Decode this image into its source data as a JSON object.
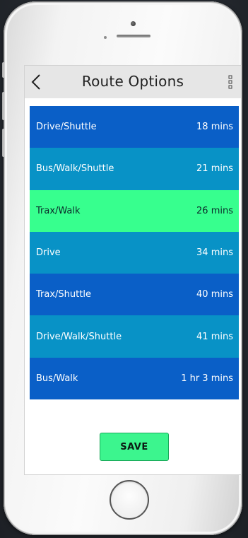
{
  "header": {
    "title": "Route Options"
  },
  "icons": {
    "back": "chevron-left-icon",
    "menu": "vertical-dots-icon",
    "home": "home-button-ring"
  },
  "routes": [
    {
      "mode": "Drive/Shuttle",
      "duration": "18 mins",
      "selected": false
    },
    {
      "mode": "Bus/Walk/Shuttle",
      "duration": "21 mins",
      "selected": false
    },
    {
      "mode": "Trax/Walk",
      "duration": "26 mins",
      "selected": true
    },
    {
      "mode": "Drive",
      "duration": "34 mins",
      "selected": false
    },
    {
      "mode": "Trax/Shuttle",
      "duration": "40 mins",
      "selected": false
    },
    {
      "mode": "Drive/Walk/Shuttle",
      "duration": "41 mins",
      "selected": false
    },
    {
      "mode": "Bus/Walk",
      "duration": "1 hr 3 mins",
      "selected": false
    }
  ],
  "actions": {
    "save_label": "SAVE"
  },
  "colors": {
    "row_dark": "#0a5fc7",
    "row_light": "#0892c6",
    "selected": "#37ff8e",
    "save_button": "#3cf58e",
    "header_bg": "#e6e6e6"
  }
}
